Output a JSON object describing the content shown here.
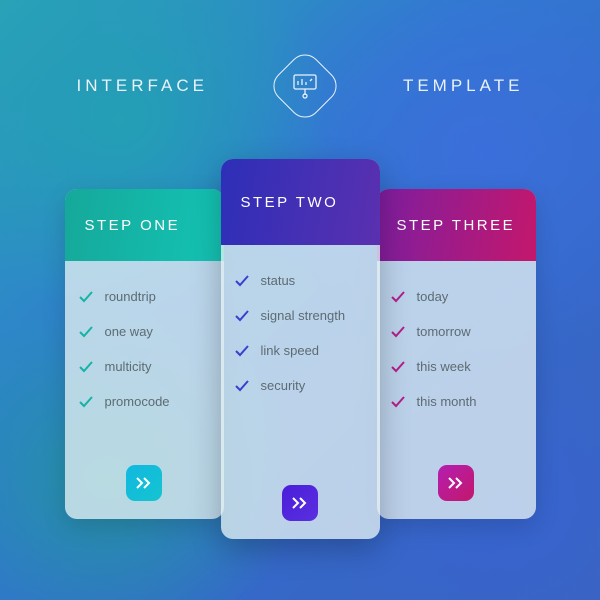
{
  "header": {
    "left": "INTERFACE",
    "right": "TEMPLATE"
  },
  "colors": {
    "card1_check": "#14b3a5",
    "card2_check": "#3a3fd0",
    "card3_check": "#b41e8a"
  },
  "cards": [
    {
      "title": "STEP ONE",
      "items": [
        "roundtrip",
        "one way",
        "multicity",
        "promocode"
      ]
    },
    {
      "title": "STEP TWO",
      "items": [
        "status",
        "signal strength",
        "link speed",
        "security"
      ]
    },
    {
      "title": "STEP THREE",
      "items": [
        "today",
        "tomorrow",
        "this week",
        "this month"
      ]
    }
  ]
}
